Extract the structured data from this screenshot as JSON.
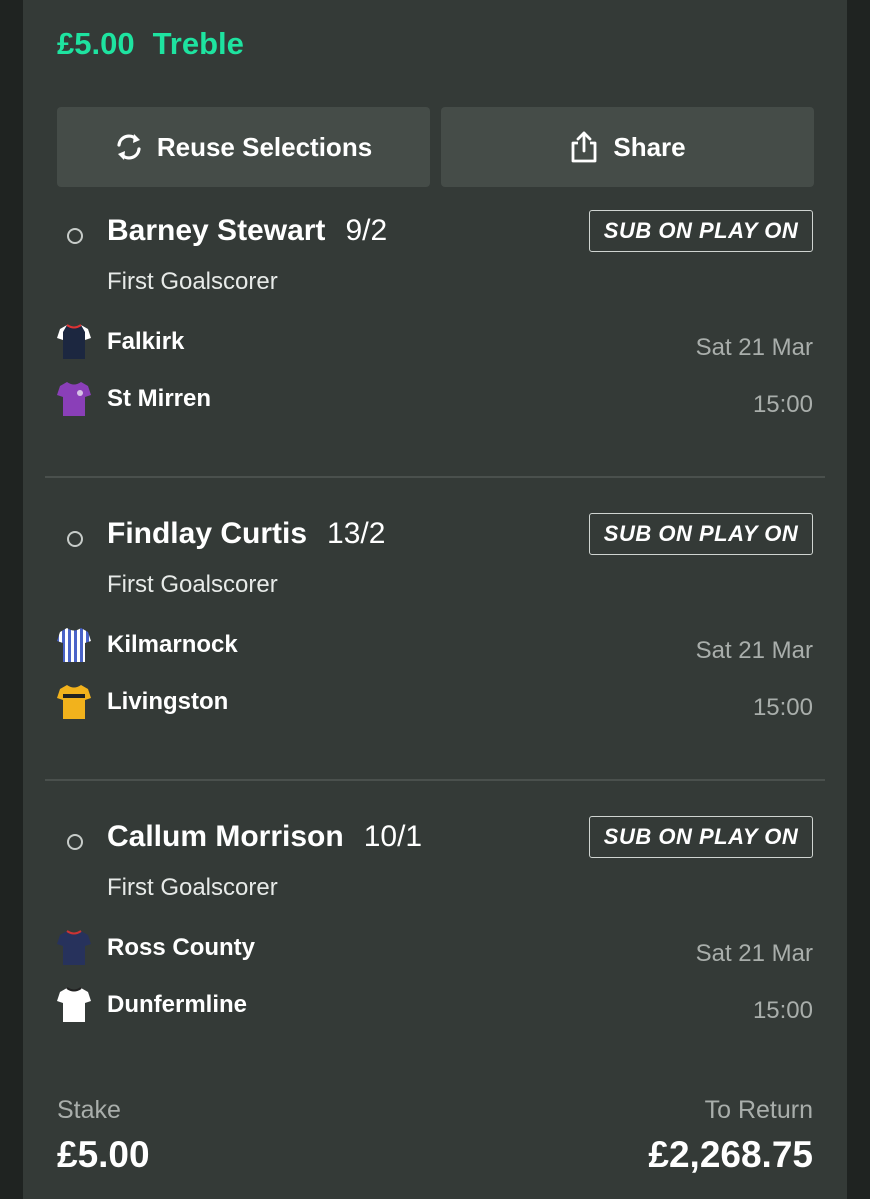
{
  "bet": {
    "stake_amount": "£5.00",
    "bet_type": "Treble"
  },
  "actions": {
    "reuse_label": "Reuse Selections",
    "share_label": "Share"
  },
  "selections": [
    {
      "player": "Barney Stewart",
      "odds": "9/2",
      "market": "First Goalscorer",
      "badge": "SUB ON PLAY ON",
      "home_team": "Falkirk",
      "away_team": "St Mirren",
      "date": "Sat 21 Mar",
      "time": "15:00",
      "home_kit_color": "#1c2740",
      "away_kit_color": "#8a3fb8"
    },
    {
      "player": "Findlay Curtis",
      "odds": "13/2",
      "market": "First Goalscorer",
      "badge": "SUB ON PLAY ON",
      "home_team": "Kilmarnock",
      "away_team": "Livingston",
      "date": "Sat 21 Mar",
      "time": "15:00",
      "home_kit_color": "#4a63c8",
      "away_kit_color": "#f2b21c"
    },
    {
      "player": "Callum Morrison",
      "odds": "10/1",
      "market": "First Goalscorer",
      "badge": "SUB ON PLAY ON",
      "home_team": "Ross County",
      "away_team": "Dunfermline",
      "date": "Sat 21 Mar",
      "time": "15:00",
      "home_kit_color": "#27325c",
      "away_kit_color": "#ffffff"
    }
  ],
  "footer": {
    "stake_label": "Stake",
    "stake_value": "£5.00",
    "return_label": "To Return",
    "return_value": "£2,268.75"
  },
  "colors": {
    "accent": "#1ee3a0",
    "panel": "#343a37",
    "button": "#454c48"
  },
  "icons": [
    "refresh-icon",
    "share-icon",
    "radio-icon",
    "team-kit-icon"
  ]
}
